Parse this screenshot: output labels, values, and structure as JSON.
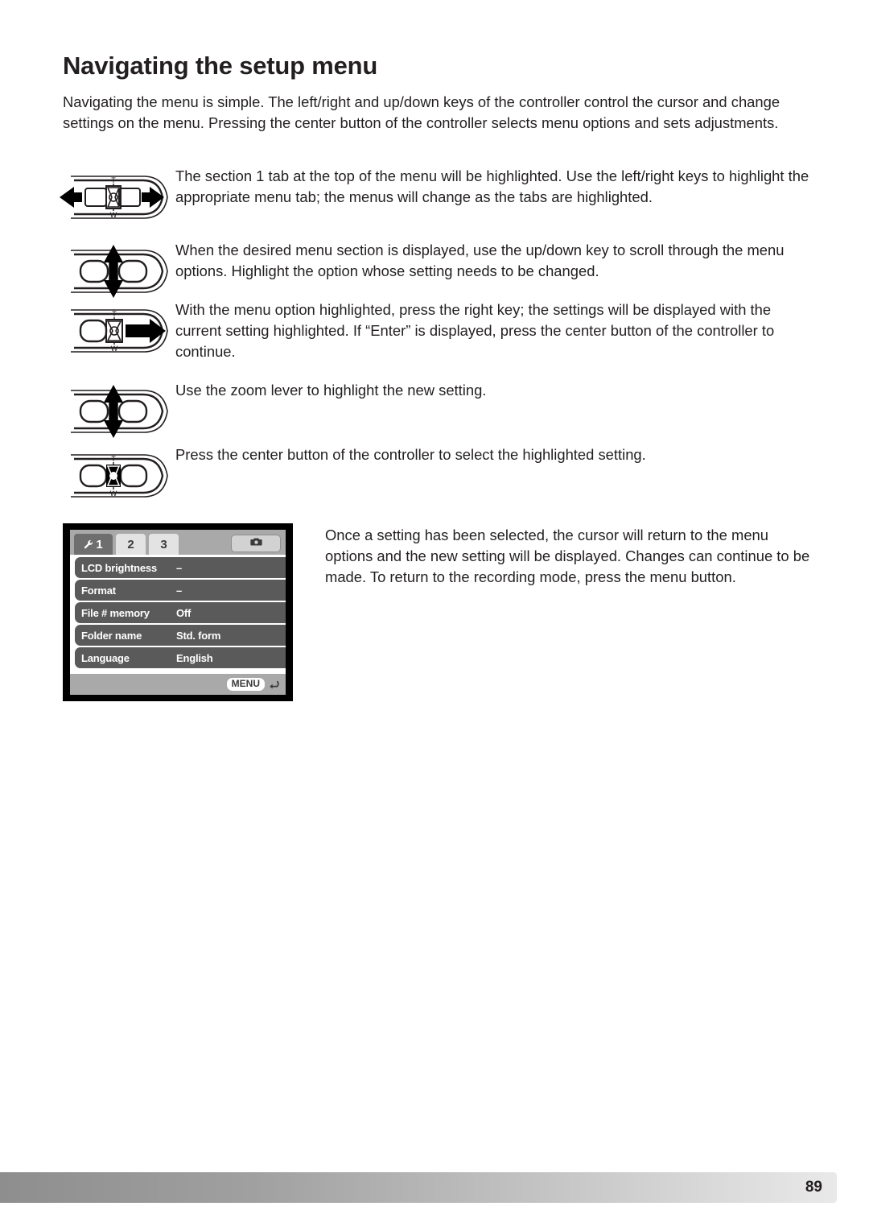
{
  "page": {
    "title": "Navigating the setup menu",
    "intro": "Navigating the menu is simple. The left/right and up/down keys of the controller control the cursor and change settings on the menu. Pressing the center button of the controller selects menu options and sets adjustments.",
    "number": "89"
  },
  "steps": [
    {
      "icon": "zoom-lever-left-right-icon",
      "text": "The section 1 tab at the top of the menu will be highlighted. Use the left/right keys to highlight the appropriate menu tab; the menus will change as the tabs are highlighted."
    },
    {
      "icon": "zoom-lever-up-down-icon",
      "text": "When the desired menu section is displayed, use the up/down key to scroll through the menu options. Highlight the option whose setting needs to be changed."
    },
    {
      "icon": "zoom-lever-right-icon",
      "text": "With the menu option highlighted, press the right key; the settings will be displayed with the current setting highlighted. If “Enter” is displayed, press the center button of the controller to continue."
    },
    {
      "icon": "zoom-lever-up-down-icon",
      "text": "Use the zoom lever to highlight the new setting."
    },
    {
      "icon": "zoom-lever-center-icon",
      "text": "Press the center button of the controller to select the highlighted setting."
    }
  ],
  "lcd": {
    "tabs": [
      {
        "label": "1",
        "icon": "wrench-icon",
        "active": true
      },
      {
        "label": "2",
        "icon": "",
        "active": false
      },
      {
        "label": "3",
        "icon": "",
        "active": false
      }
    ],
    "camera_button_icon": "camera-icon",
    "rows": [
      {
        "label": "LCD brightness",
        "value": "–"
      },
      {
        "label": "Format",
        "value": "–"
      },
      {
        "label": "File # memory",
        "value": "Off"
      },
      {
        "label": "Folder name",
        "value": "Std. form"
      },
      {
        "label": "Language",
        "value": "English"
      }
    ],
    "menu_badge": "MENU",
    "return_icon": "return-arrow-icon"
  },
  "lcd_note": "Once a setting has been selected, the cursor will return to the menu options and the new setting will be displayed. Changes can continue to be made. To return to the recording mode, press the menu button.",
  "colors": {
    "text": "#231f20",
    "lcd_row": "#5a5a5a",
    "lcd_tabbar": "#a9a9a9",
    "lcd_tab_active": "#6e6e6e"
  }
}
